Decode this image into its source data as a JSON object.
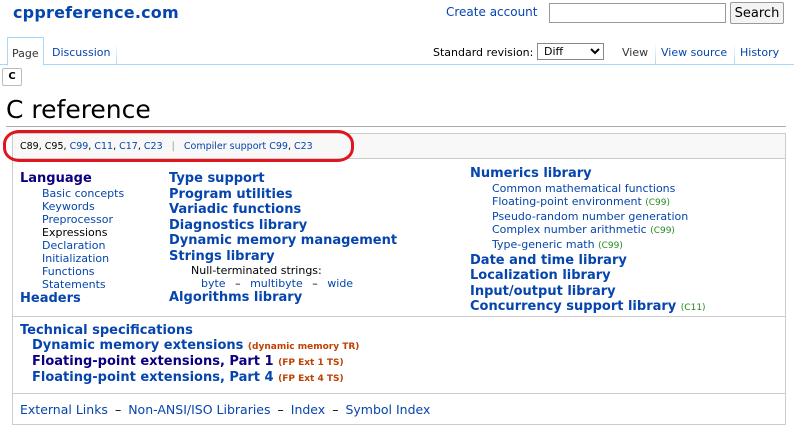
{
  "site": {
    "logo": "cppreference.com"
  },
  "header": {
    "create_account": "Create account",
    "search_placeholder": "",
    "search_button": "Search"
  },
  "tabs": {
    "page": "Page",
    "discussion": "Discussion",
    "standard_revision_label": "Standard revision:",
    "standard_revision_value": "Diff",
    "view": "View",
    "view_source": "View source",
    "history": "History"
  },
  "lang_tab": "C",
  "page_title": "C reference",
  "standards_row": {
    "versions": [
      "C89",
      "C95",
      "C99",
      "C11",
      "C17",
      "C23"
    ],
    "compiler_support_label": "Compiler support",
    "compiler_support_versions": [
      "C99",
      "C23"
    ]
  },
  "column1": {
    "language": {
      "title": "Language",
      "items": [
        "Basic concepts",
        "Keywords",
        "Preprocessor",
        "Expressions",
        "Declaration",
        "Initialization",
        "Functions",
        "Statements"
      ]
    },
    "headers": "Headers"
  },
  "column2": {
    "type_support": "Type support",
    "program_utilities": "Program utilities",
    "variadic_functions": "Variadic functions",
    "diagnostics_library": "Diagnostics library",
    "dynamic_memory": "Dynamic memory management",
    "strings_library": "Strings library",
    "null_terminated_label": "Null-terminated strings:",
    "null_terminated_items": [
      "byte",
      "multibyte",
      "wide"
    ],
    "algorithms_library": "Algorithms library"
  },
  "column3": {
    "numerics": {
      "title": "Numerics library",
      "items": [
        {
          "label": "Common mathematical functions",
          "ver": ""
        },
        {
          "label": "Floating-point environment",
          "ver": "(C99)"
        },
        {
          "label": "Pseudo-random number generation",
          "ver": ""
        },
        {
          "label": "Complex number arithmetic",
          "ver": "(C99)"
        },
        {
          "label": "Type-generic math",
          "ver": "(C99)"
        }
      ]
    },
    "date_time": "Date and time library",
    "localization": "Localization library",
    "io": "Input/output library",
    "concurrency": "Concurrency support library",
    "concurrency_ver": "(C11)"
  },
  "tech_specs": {
    "title": "Technical specifications",
    "items": [
      {
        "label": "Dynamic memory extensions",
        "ts": "(dynamic memory TR)"
      },
      {
        "label": "Floating-point extensions, Part 1",
        "ts": "(FP Ext 1 TS)"
      },
      {
        "label": "Floating-point extensions, Part 4",
        "ts": "(FP Ext 4 TS)"
      }
    ]
  },
  "footer": {
    "separator": "–",
    "links": [
      "External Links",
      "Non-ANSI/ISO Libraries",
      "Index",
      "Symbol Index"
    ]
  },
  "colors": {
    "link": "#0645ad",
    "annotation_red": "#e0161e",
    "version_green": "#228b22",
    "ts_orange": "#c04000"
  }
}
